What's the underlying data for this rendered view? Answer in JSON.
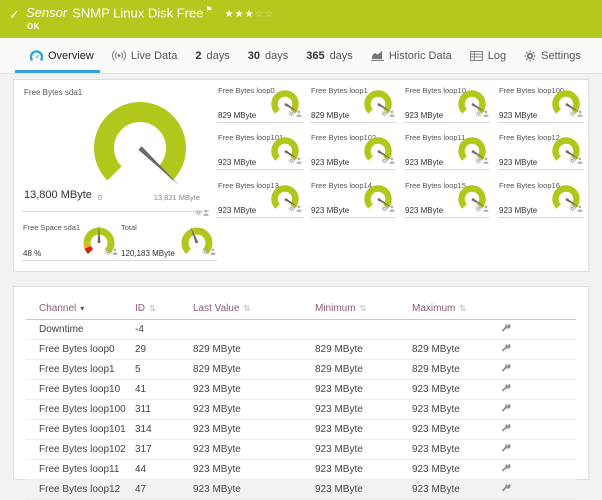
{
  "header": {
    "kind_label": "Sensor",
    "title": "SNMP Linux Disk Free",
    "status": "OK",
    "priority": {
      "filled": 3,
      "total": 5
    }
  },
  "icons": {
    "check": "✓",
    "flag": "⚑",
    "star_filled": "★",
    "star_empty": "☆",
    "sort_active": "▾",
    "sort_inactive": "⇅"
  },
  "tabs": [
    {
      "label": "Overview",
      "icon": "gauge-icon",
      "active": true
    },
    {
      "label": "Live Data",
      "icon": "live-icon",
      "active": false
    },
    {
      "num": "2",
      "label": "days",
      "active": false
    },
    {
      "num": "30",
      "label": "days",
      "active": false
    },
    {
      "num": "365",
      "label": "days",
      "active": false
    },
    {
      "label": "Historic Data",
      "icon": "chart-icon",
      "active": false
    },
    {
      "label": "Log",
      "icon": "log-icon",
      "active": false
    },
    {
      "label": "Settings",
      "icon": "gear-icon",
      "active": false
    }
  ],
  "gauges": {
    "main": {
      "title": "Free Bytes sda1",
      "value": "13,800 MByte",
      "min_label": "0",
      "max_label": "13,821 MByte",
      "needle": 0.995
    },
    "small_needle": 0.95,
    "small": [
      {
        "title": "Free Bytes loop0",
        "value": "829 MByte"
      },
      {
        "title": "Free Bytes loop1",
        "value": "829 MByte"
      },
      {
        "title": "Free Bytes loop10",
        "value": "923 MByte"
      },
      {
        "title": "Free Bytes loop100",
        "value": "923 MByte"
      },
      {
        "title": "Free Bytes loop101",
        "value": "923 MByte"
      },
      {
        "title": "Free Bytes loop102",
        "value": "923 MByte"
      },
      {
        "title": "Free Bytes loop11",
        "value": "923 MByte"
      },
      {
        "title": "Free Bytes loop12",
        "value": "923 MByte"
      },
      {
        "title": "Free Bytes loop13",
        "value": "923 MByte"
      },
      {
        "title": "Free Bytes loop14",
        "value": "923 MByte"
      },
      {
        "title": "Free Bytes loop15",
        "value": "923 MByte"
      },
      {
        "title": "Free Bytes loop16",
        "value": "923 MByte"
      }
    ],
    "bottom": [
      {
        "title": "Free Space sda1",
        "value": "48 %",
        "needle": 0.5,
        "segments": "limits"
      },
      {
        "title": "Total",
        "value": "120,183 MByte",
        "needle": 0.42,
        "segments": "plain"
      }
    ]
  },
  "table": {
    "columns": [
      "Channel",
      "ID",
      "Last Value",
      "Minimum",
      "Maximum"
    ],
    "sorted_column": "Channel",
    "rows": [
      {
        "channel": "Downtime",
        "id": "-4",
        "last": "",
        "min": "",
        "max": ""
      },
      {
        "channel": "Free Bytes loop0",
        "id": "29",
        "last": "829 MByte",
        "min": "829 MByte",
        "max": "829 MByte"
      },
      {
        "channel": "Free Bytes loop1",
        "id": "5",
        "last": "829 MByte",
        "min": "829 MByte",
        "max": "829 MByte"
      },
      {
        "channel": "Free Bytes loop10",
        "id": "41",
        "last": "923 MByte",
        "min": "923 MByte",
        "max": "923 MByte"
      },
      {
        "channel": "Free Bytes loop100",
        "id": "311",
        "last": "923 MByte",
        "min": "923 MByte",
        "max": "923 MByte"
      },
      {
        "channel": "Free Bytes loop101",
        "id": "314",
        "last": "923 MByte",
        "min": "923 MByte",
        "max": "923 MByte"
      },
      {
        "channel": "Free Bytes loop102",
        "id": "317",
        "last": "923 MByte",
        "min": "923 MByte",
        "max": "923 MByte"
      },
      {
        "channel": "Free Bytes loop11",
        "id": "44",
        "last": "923 MByte",
        "min": "923 MByte",
        "max": "923 MByte"
      },
      {
        "channel": "Free Bytes loop12",
        "id": "47",
        "last": "923 MByte",
        "min": "923 MByte",
        "max": "923 MByte"
      }
    ]
  },
  "colors": {
    "ok_green": "#b5c81e",
    "gauge_green": "#b2c71c",
    "accent_blue": "#35a3d7",
    "header_purple": "#8a5a78",
    "limit_red": "#d62014",
    "limit_orange": "#eab016",
    "needle": "#6b6b6b"
  }
}
